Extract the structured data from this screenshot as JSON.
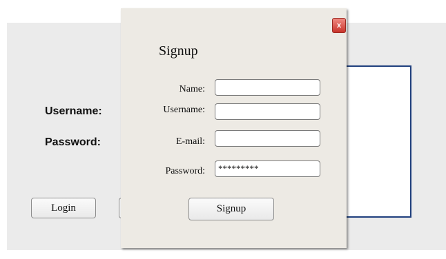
{
  "background_form": {
    "username_label": "Username:",
    "password_label": "Password:",
    "login_label": "Login"
  },
  "signup_dialog": {
    "title": "Signup",
    "close_label": "x",
    "fields": [
      {
        "label": "Name:",
        "value": "",
        "placeholder": ""
      },
      {
        "label": "Username:",
        "value": "",
        "placeholder": ""
      },
      {
        "label": "E-mail:",
        "value": "",
        "placeholder": ""
      },
      {
        "label": "Password:",
        "value": "*********",
        "placeholder": ""
      }
    ],
    "submit_label": "Signup"
  },
  "colors": {
    "dialog_background": "#edeae4",
    "panel_background": "#ebebeb",
    "accent_border": "#1f3f7d",
    "close_button": "#d9463c"
  }
}
